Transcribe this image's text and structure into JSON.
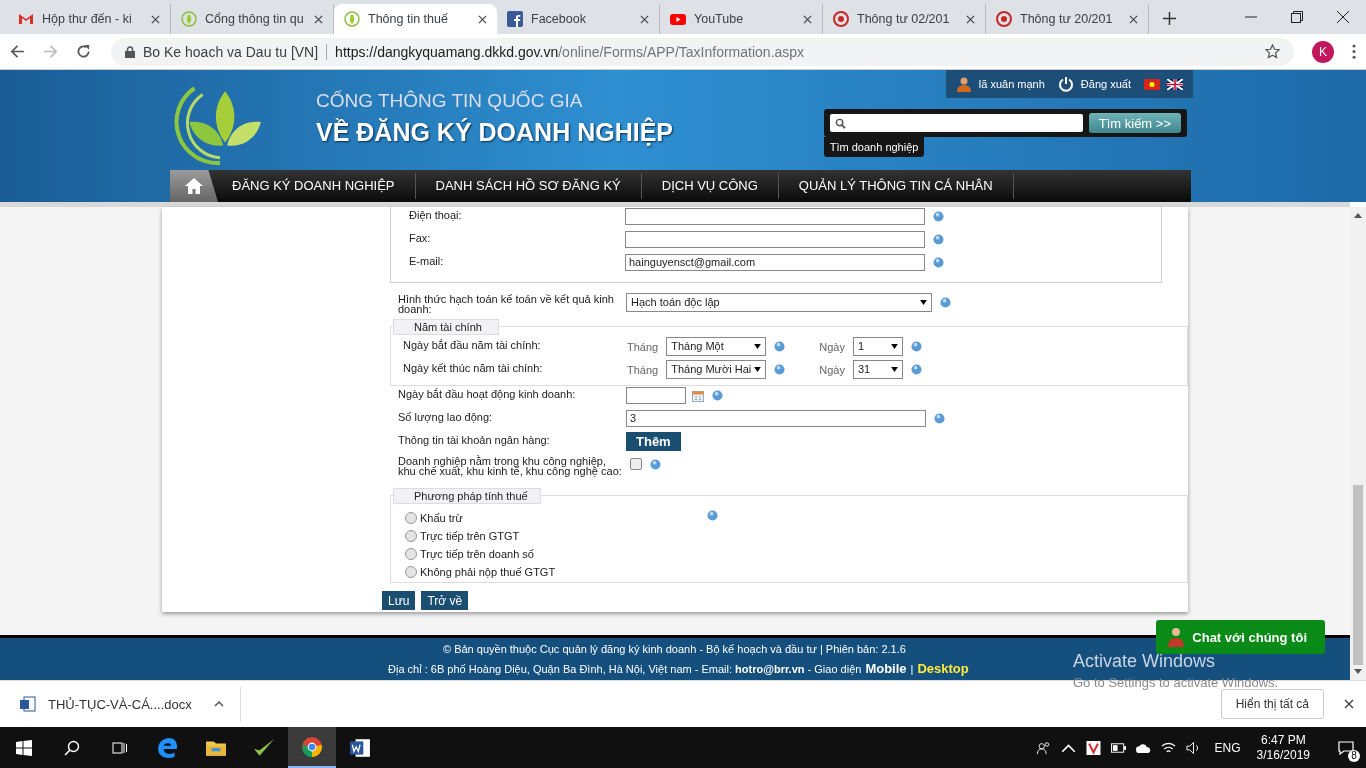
{
  "browser": {
    "tabs": [
      {
        "title": "Hộp thư đến - ki",
        "kind": "mail",
        "selected": false
      },
      {
        "title": "Cổng thông tin qu",
        "kind": "portal",
        "selected": false
      },
      {
        "title": "Thông tin thuế",
        "kind": "portal",
        "selected": true
      },
      {
        "title": "Facebook",
        "kind": "facebook",
        "selected": false
      },
      {
        "title": "YouTube",
        "kind": "youtube",
        "selected": false
      },
      {
        "title": "Thông tư 02/201",
        "kind": "seal",
        "selected": false
      },
      {
        "title": "Thông tư 20/201",
        "kind": "seal",
        "selected": false
      }
    ],
    "site_label": "Bo Ke hoach va Dau tu [VN]",
    "url_host": "https://dangkyquamang.dkkd.gov.vn",
    "url_path": "/online/Forms/APP/TaxInformation.aspx",
    "avatar": "K"
  },
  "header": {
    "line1": "CỔNG THÔNG TIN QUỐC GIA",
    "line2": "VỀ ĐĂNG KÝ DOANH NGHIỆP",
    "user": "lã xuân mạnh",
    "logout": "Đăng xuất",
    "search_button": "Tìm kiếm >>",
    "search_tab": "Tìm doanh nghiệp"
  },
  "nav": [
    "ĐĂNG KÝ DOANH NGHIỆP",
    "DANH SÁCH HỒ SƠ ĐĂNG KÝ",
    "DỊCH VỤ CÔNG",
    "QUẢN LÝ THÔNG TIN CÁ NHÂN"
  ],
  "contact": [
    {
      "label": "Điện thoại:"
    },
    {
      "label": "Fax:"
    },
    {
      "label": "E-mail:",
      "value": "hainguyensct@gmail.com"
    }
  ],
  "accounting": {
    "label": "Hình thức hạch toán kế toán về kết quả kinh doanh:",
    "value": "Hạch toán độc lập"
  },
  "fiscal_year": {
    "legend": "Năm tài chính",
    "rows": [
      {
        "label": "Ngày bắt đầu năm tài chính:",
        "month_label": "Tháng",
        "month": "Tháng Một",
        "day_label": "Ngày",
        "day": "1"
      },
      {
        "label": "Ngày kết thúc năm tài chính:",
        "month_label": "Tháng",
        "month": "Tháng Mười Hai",
        "day_label": "Ngày",
        "day": "31"
      }
    ]
  },
  "start_date": {
    "label": "Ngày bắt đầu hoạt động kinh doanh:"
  },
  "employees": {
    "label": "Số lượng lao động:",
    "value": "3"
  },
  "bank": {
    "label": "Thông tin tài khoản ngân hàng:",
    "button": "Thêm"
  },
  "industrial_zone": {
    "label": "Doanh nghiệp nằm trong khu công nghiệp, khu chế xuất, khu kinh tế, khu công nghệ cao:",
    "checked": false
  },
  "tax_method": {
    "legend": "Phương pháp tính thuế",
    "options": [
      {
        "label": "Khấu trừ",
        "selected": false
      },
      {
        "label": "Trực tiếp trên GTGT",
        "selected": false
      },
      {
        "label": "Trực tiếp trên doanh số",
        "selected": false
      },
      {
        "label": "Không phải nộp thuế GTGT",
        "selected": false
      }
    ]
  },
  "actions": [
    "Lưu",
    "Trở về"
  ],
  "footer": {
    "copyright": "© Bản quyền thuộc Cục quản lý đăng ký kinh doanh - Bộ kế hoạch và đầu tư | Phiên bản: 2.1.6",
    "address": "Địa chỉ : 6B phố Hoàng Diệu, Quận Ba Đình, Hà Nội, Việt nam - Email: **hotro@brr.vn** - Giao diện",
    "mobile": "Mobile",
    "separator": "|",
    "desktop": "Desktop"
  },
  "chat": "Chat với chúng tôi",
  "activation": {
    "title": "Activate Windows",
    "subtitle": "Go to Settings to activate Windows."
  },
  "downloads": {
    "file": "THỦ-TỤC-VÀ-CÁ....docx",
    "show_all": "Hiển thị tất cả"
  },
  "taskbar": {
    "apps": [
      {
        "kind": "edge",
        "selected": false
      },
      {
        "kind": "explorer",
        "selected": false
      },
      {
        "kind": "check",
        "selected": false
      },
      {
        "kind": "chrome",
        "selected": true
      },
      {
        "kind": "word",
        "selected": false
      }
    ],
    "language": "ENG",
    "time": "6:47 PM",
    "date": "3/16/2019",
    "notifications": "8"
  }
}
